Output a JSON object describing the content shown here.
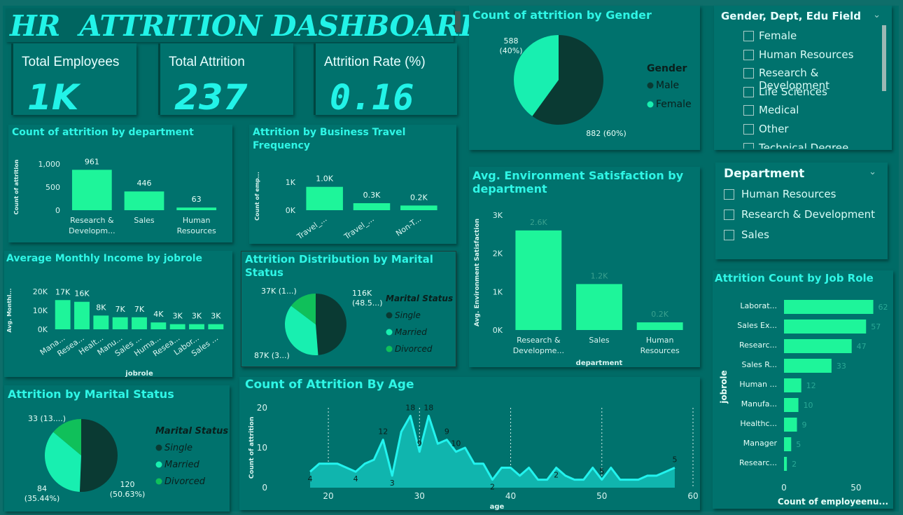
{
  "title": "HR  ATTRITION DASHBOARD",
  "kpis": [
    {
      "label": "Total Employees",
      "value": "1K"
    },
    {
      "label": "Total Attrition",
      "value": "237"
    },
    {
      "label": "Attrition Rate (%)",
      "value": "0.16"
    }
  ],
  "colors": {
    "background": "#006b66",
    "card": "#00726d",
    "bar": "#1ef59a",
    "dark": "#0a3a33",
    "light": "#18efb0",
    "mid": "#10c05a",
    "title": "#2ff6e6"
  },
  "charts": {
    "dept": {
      "title": "Count of attrition by department",
      "ylabel": "Count of attrition",
      "yticks": [
        "1,000",
        "500",
        "0"
      ],
      "chart_data": {
        "type": "bar",
        "categories": [
          "Research & Developm...",
          "Sales",
          "Human Resources"
        ],
        "values": [
          961,
          446,
          63
        ],
        "ylim": [
          0,
          1100
        ]
      },
      "cat_lines": [
        [
          "Research &",
          "Developm..."
        ],
        [
          "Sales"
        ],
        [
          "Human",
          "Resources"
        ]
      ],
      "labels": [
        "961",
        "446",
        "63"
      ]
    },
    "travel": {
      "title": [
        "Attrition by Business Travel",
        "Frequency"
      ],
      "ylabel": "Count of emp...",
      "yticks": [
        "1K",
        "0K"
      ],
      "chart_data": {
        "type": "bar",
        "categories": [
          "Travel_...",
          "Travel_...",
          "Non-T..."
        ],
        "values": [
          1000,
          300,
          200
        ],
        "ylim": [
          0,
          1200
        ]
      },
      "labels": [
        "1.0K",
        "0.3K",
        "0.2K"
      ]
    },
    "income": {
      "title": "Average Monthly Income by jobrole",
      "ylabel": "Avg. Monthl...",
      "xlabel": "jobrole",
      "yticks": [
        "20K",
        "10K",
        "0K"
      ],
      "chart_data": {
        "type": "bar",
        "categories": [
          "Mana...",
          "Resea...",
          "Healt...",
          "Manu...",
          "Sales ...",
          "Huma...",
          "Resea...",
          "Labor...",
          "Sales ..."
        ],
        "values": [
          17,
          16,
          8,
          7,
          7,
          4,
          3,
          3,
          3
        ],
        "ylim": [
          0,
          22
        ]
      },
      "labels": [
        "17K",
        "16K",
        "8K",
        "7K",
        "7K",
        "4K",
        "3K",
        "3K",
        "3K"
      ]
    },
    "gender": {
      "title": "Count of attrition by Gender",
      "legend_title": "Gender",
      "chart_data": {
        "type": "pie",
        "categories": [
          "Male",
          "Female"
        ],
        "values": [
          882,
          588
        ]
      },
      "slice_labels": [
        [
          "882 (60%)"
        ],
        [
          "588",
          "(40%)"
        ]
      ]
    },
    "marital1": {
      "title": [
        "Attrition Distribution by Marital",
        "Status"
      ],
      "legend_title": "Marital Status",
      "chart_data": {
        "type": "pie",
        "categories": [
          "Single",
          "Married",
          "Divorced"
        ],
        "values": [
          116,
          87,
          35
        ]
      },
      "slice_labels": [
        [
          "116K",
          "(48.5...)"
        ],
        [
          "87K (3...)"
        ],
        [
          "37K (1...)"
        ]
      ]
    },
    "marital2": {
      "title": "Attrition by Marital Status",
      "legend_title": "Marital Status",
      "chart_data": {
        "type": "pie",
        "categories": [
          "Single",
          "Married",
          "Divorced"
        ],
        "values": [
          120,
          84,
          33
        ]
      },
      "slice_labels": [
        [
          "120",
          "(50.63%)"
        ],
        [
          "84",
          "(35.44%)"
        ],
        [
          "33 (13....)"
        ]
      ]
    },
    "env": {
      "title": [
        "Avg. Environment Satisfaction by",
        "department"
      ],
      "ylabel": "Avg. Environment Satisfaction",
      "xlabel": "department",
      "yticks": [
        "3K",
        "2K",
        "1K",
        "0K"
      ],
      "chart_data": {
        "type": "bar",
        "categories": [
          "Research & Developme...",
          "Sales",
          "Human Resources"
        ],
        "values": [
          2600,
          1200,
          200
        ],
        "ylim": [
          0,
          3000
        ]
      },
      "cat_lines": [
        [
          "Research &",
          "Developme..."
        ],
        [
          "Sales"
        ],
        [
          "Human",
          "Resources"
        ]
      ],
      "labels": [
        "2.6K",
        "1.2K",
        "0.2K"
      ]
    },
    "age": {
      "title": "Count of Attrition By Age",
      "ylabel": "Count of attrition",
      "xlabel": "age",
      "yticks": [
        "20",
        "10",
        "0"
      ],
      "xticks": [
        "20",
        "30",
        "40",
        "50",
        "60"
      ],
      "chart_data": {
        "type": "area",
        "x": [
          18,
          19,
          20,
          21,
          22,
          23,
          24,
          25,
          26,
          27,
          28,
          29,
          30,
          31,
          32,
          33,
          34,
          35,
          36,
          37,
          38,
          39,
          40,
          41,
          42,
          43,
          44,
          45,
          46,
          47,
          48,
          49,
          50,
          51,
          52,
          53,
          54,
          55,
          56,
          57,
          58
        ],
        "y": [
          4,
          6,
          6,
          6,
          5,
          4,
          6,
          7,
          12,
          3,
          14,
          18,
          9,
          18,
          11,
          12,
          9,
          10,
          6,
          6,
          2,
          5,
          5,
          3,
          5,
          2,
          2,
          5,
          3,
          2,
          2,
          5,
          2,
          5,
          2,
          2,
          2,
          3,
          3,
          4,
          5
        ],
        "xlim": [
          17,
          60
        ],
        "ylim": [
          0,
          20
        ]
      },
      "point_labels": [
        [
          "18",
          "4"
        ],
        [
          "23",
          "4"
        ],
        [
          "26",
          "12"
        ],
        [
          "27",
          "3"
        ],
        [
          "29",
          "18"
        ],
        [
          "30",
          "9"
        ],
        [
          "31",
          "18"
        ],
        [
          "33",
          "9"
        ],
        [
          "34",
          "10"
        ],
        [
          "38",
          "2"
        ],
        [
          "45",
          "2"
        ],
        [
          "50",
          "5"
        ],
        [
          "58",
          "5"
        ]
      ]
    },
    "jobrole": {
      "title": "Attrition Count by Job Role",
      "ylabel": "jobrole",
      "xlabel": "Count of employeenu...",
      "xticks": [
        "0",
        "50"
      ],
      "chart_data": {
        "type": "bar",
        "categories": [
          "Laborat...",
          "Sales Ex...",
          "Researc...",
          "Sales R...",
          "Human ...",
          "Manufa...",
          "Healthc...",
          "Manager",
          "Researc..."
        ],
        "values": [
          62,
          57,
          47,
          33,
          12,
          10,
          9,
          5,
          2
        ],
        "xlim": [
          0,
          70
        ]
      },
      "labels": [
        "62",
        "57",
        "47",
        "33",
        "12",
        "10",
        "9",
        "5",
        "2"
      ]
    }
  },
  "slicer1": {
    "title": "Gender, Dept, Edu Field",
    "items": [
      {
        "label": "Female",
        "arrow": "^"
      },
      {
        "label": "Human Resources",
        "arrow": "v"
      },
      {
        "label": "Research & Development",
        "arrow": "^"
      },
      {
        "label": "Life Sciences",
        "arrow": ""
      },
      {
        "label": "Medical",
        "arrow": ""
      },
      {
        "label": "Other",
        "arrow": ""
      },
      {
        "label": "Technical Degree",
        "arrow": ""
      }
    ]
  },
  "slicer2": {
    "title": "Department",
    "items": [
      {
        "label": "Human Resources"
      },
      {
        "label": "Research & Development"
      },
      {
        "label": "Sales"
      }
    ]
  }
}
